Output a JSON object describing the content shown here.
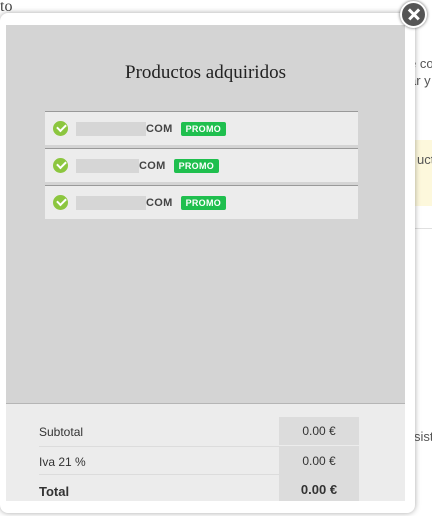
{
  "background": {
    "title_fragment": "to",
    "right_fragments": [
      "e co",
      "ar y",
      "ucto",
      "sist"
    ]
  },
  "modal": {
    "title": "Productos adquiridos",
    "products": [
      {
        "suffix": "COM",
        "badge": "PROMO"
      },
      {
        "suffix": "COM",
        "badge": "PROMO"
      },
      {
        "suffix": "COM",
        "badge": "PROMO"
      }
    ],
    "summary": {
      "subtotal_label": "Subtotal",
      "subtotal_value": "0.00 €",
      "iva_label": "Iva 21 %",
      "iva_value": "0.00 €",
      "total_label": "Total",
      "total_value": "0.00 €"
    }
  },
  "colors": {
    "check": "#8cc63f",
    "promo": "#1fbf4e",
    "panel": "#d4d4d4"
  },
  "icons": {
    "close": "close-icon",
    "check": "check-circle-icon"
  }
}
